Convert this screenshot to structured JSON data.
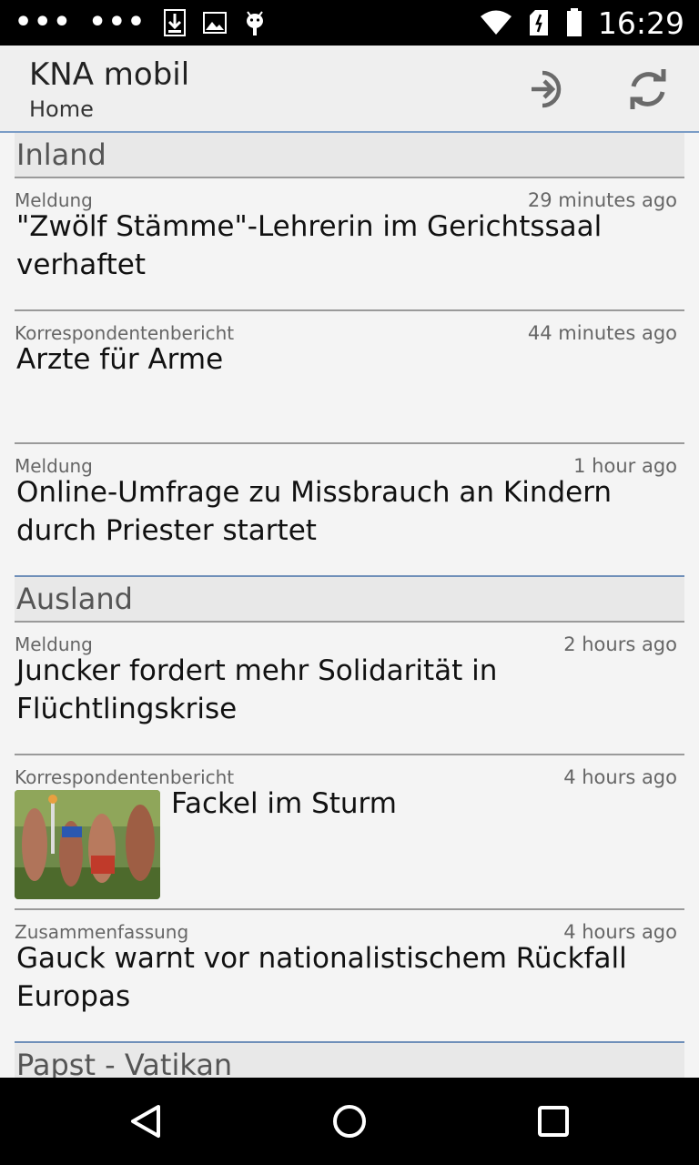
{
  "status_bar": {
    "time": "16:29",
    "icons": [
      "more-dots-icon",
      "download-icon",
      "image-icon",
      "android-icon",
      "wifi-icon",
      "sim-icon",
      "battery-icon"
    ]
  },
  "app_bar": {
    "title": "KNA mobil",
    "subtitle": "Home",
    "actions": [
      "login-icon",
      "refresh-icon"
    ]
  },
  "sections": [
    {
      "name": "Inland",
      "items": [
        {
          "type": "Meldung",
          "time": "29 minutes ago",
          "title": "\"Zwölf Stämme\"-Lehrerin im Gerichtssaal verhaftet"
        },
        {
          "type": "Korrespondentenbericht",
          "time": "44 minutes ago",
          "title": "Arzte für Arme"
        },
        {
          "type": "Meldung",
          "time": "1 hour ago",
          "title": "Online-Umfrage zu Missbrauch an Kindern durch Priester startet"
        }
      ]
    },
    {
      "name": "Ausland",
      "items": [
        {
          "type": "Meldung",
          "time": "2 hours ago",
          "title": "Juncker fordert mehr Solidarität in Flüchtlingskrise"
        },
        {
          "type": "Korrespondentenbericht",
          "time": "4 hours ago",
          "title": "Fackel im Sturm",
          "has_image": true
        },
        {
          "type": "Zusammenfassung",
          "time": "4 hours ago",
          "title": "Gauck warnt vor nationalistischem Rückfall Europas"
        }
      ]
    },
    {
      "name": "Papst - Vatikan",
      "items": []
    }
  ],
  "nav_bar": {
    "buttons": [
      "back-icon",
      "home-icon",
      "recents-icon"
    ]
  },
  "colors": {
    "accent_line": "#6f8fb9",
    "background": "#f4f4f4",
    "section_bg": "#e8e8e8"
  }
}
